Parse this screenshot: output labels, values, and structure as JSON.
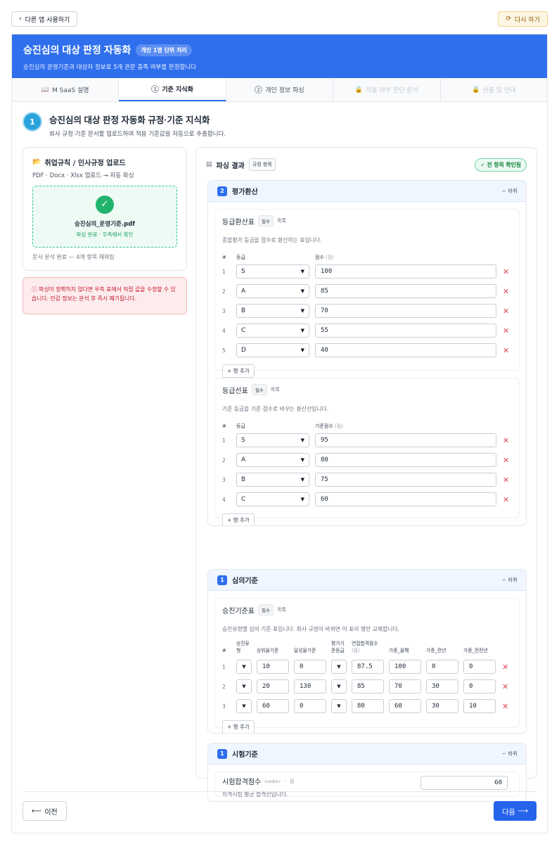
{
  "topbar": {
    "back_label": "다른 앱 사용하기",
    "retry_label": "다시 하기"
  },
  "hero": {
    "title": "승진심의 대상 판정 자동화",
    "badge": "개인 1명 단위 처리",
    "subtitle": "승진심의 운영기준과 대상자 정보로 5개 관문 충족 여부를 판정합니다"
  },
  "tabs": [
    {
      "icon": "📖",
      "label": "M SaaS 설명"
    },
    {
      "num": "1",
      "label": "기준 지식화"
    },
    {
      "num": "2",
      "label": "개인 정보 파싱"
    },
    {
      "icon": "🔒",
      "label": "적용 여부 판단·분석"
    },
    {
      "icon": "🔒",
      "label": "산출 및 안내"
    }
  ],
  "step": {
    "num": "1",
    "title": "승진심의 대상 판정 자동화 규정·기준 지식화",
    "subtitle": "회사 규정·기준 문서를 업로드하여 적용 기준값을 자동으로 추출합니다."
  },
  "upload": {
    "title": "취업규칙 / 인사규정 업로드",
    "subtitle": "PDF · Docx · Xlsx 업로드 → 자동 파싱",
    "file_name": "승진심의_운영기준.pdf",
    "status": "파싱 완료 · 우측에서 확인",
    "footer": "문서 분석 완료 — 4개 항목 채워짐"
  },
  "alert": {
    "text": "ⓘ 파싱이 정확하지 않다면 우측 표에서 직접 값을 수정할 수 있습니다. 민감 정보는 분석 후 즉시 폐기됩니다."
  },
  "result": {
    "title": "파싱 결과",
    "chip": "규정 항목",
    "confirm_badge": "✓ 전 항목 확인됨"
  },
  "sections": {
    "grade": {
      "num": "2",
      "title": "평가환산",
      "toggle": "− 하위",
      "conv": {
        "title": "등급환산표",
        "required": "필수",
        "type": "목록",
        "desc": "종합평가 등급을 점수로 환산하는 표입니다.",
        "col_idx": "#",
        "col_grade": "등급",
        "col_score": "점수",
        "col_score_unit": "(점)",
        "rows": [
          {
            "i": "1",
            "grade": "S",
            "score": "100"
          },
          {
            "i": "2",
            "grade": "A",
            "score": "85"
          },
          {
            "i": "3",
            "grade": "B",
            "score": "70"
          },
          {
            "i": "4",
            "grade": "C",
            "score": "55"
          },
          {
            "i": "5",
            "grade": "D",
            "score": "40"
          }
        ],
        "add_label": "+ 행 추가"
      },
      "line": {
        "title": "등급선표",
        "required": "필수",
        "type": "목록",
        "desc": "기준 등급을 기준 점수로 바꾸는 환산선입니다.",
        "col_idx": "#",
        "col_grade": "등급",
        "col_score": "기준점수",
        "col_score_unit": "(점)",
        "rows": [
          {
            "i": "1",
            "grade": "S",
            "score": "95"
          },
          {
            "i": "2",
            "grade": "A",
            "score": "80"
          },
          {
            "i": "3",
            "grade": "B",
            "score": "75"
          },
          {
            "i": "4",
            "grade": "C",
            "score": "60"
          }
        ],
        "add_label": "+ 행 추가"
      }
    },
    "review": {
      "num": "1",
      "title": "심의기준",
      "toggle": "− 하위",
      "table": {
        "title": "승진기준표",
        "required": "필수",
        "type": "목록",
        "desc": "승진유형별 심의 기준 표입니다. 회사 규정이 바뀌면 이 표의 행만 교체합니다.",
        "cols": {
          "idx": "#",
          "type_a": "승진유",
          "type_b": "형",
          "rise": "상위율기준",
          "achieve": "달성율기준",
          "eval_a": "평가기",
          "eval_b": "준등급",
          "interview": "연접합격점수",
          "interview_unit": "(점)",
          "w_this": "가중_올해",
          "w_prev": "가중_전년",
          "w_prev2": "가중_전전년"
        },
        "rows": [
          {
            "i": "1",
            "rise": "10",
            "achieve": "0",
            "interview": "87.5",
            "w_this": "100",
            "w_prev": "0",
            "w_prev2": "0"
          },
          {
            "i": "2",
            "rise": "20",
            "achieve": "130",
            "interview": "85",
            "w_this": "70",
            "w_prev": "30",
            "w_prev2": "0"
          },
          {
            "i": "3",
            "rise": "60",
            "achieve": "0",
            "interview": "80",
            "w_this": "60",
            "w_prev": "30",
            "w_prev2": "10"
          }
        ],
        "add_label": "+ 행 추가"
      }
    },
    "exam": {
      "num": "1",
      "title": "시험기준",
      "toggle": "− 하위",
      "field": {
        "title": "시험합격점수",
        "type": "number",
        "unit": "점",
        "desc": "자격시험 평균 합격선입니다.",
        "value": "60"
      }
    }
  },
  "nav": {
    "prev_label": "이전",
    "next_label": "다음"
  }
}
